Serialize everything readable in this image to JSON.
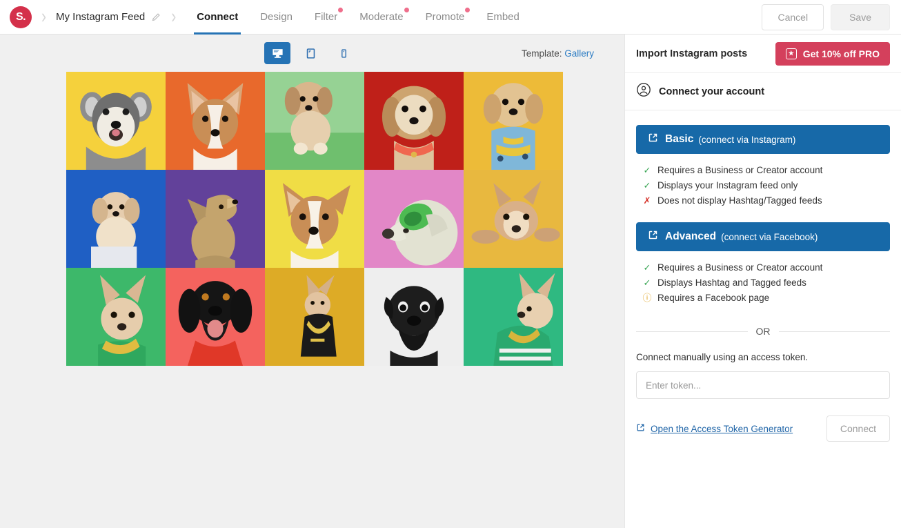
{
  "topbar": {
    "logo_text": "S.",
    "feed_name": "My Instagram Feed",
    "tabs": [
      {
        "label": "Connect",
        "active": true,
        "dot": false
      },
      {
        "label": "Design",
        "active": false,
        "dot": false
      },
      {
        "label": "Filter",
        "active": false,
        "dot": true
      },
      {
        "label": "Moderate",
        "active": false,
        "dot": true
      },
      {
        "label": "Promote",
        "active": false,
        "dot": true
      },
      {
        "label": "Embed",
        "active": false,
        "dot": false
      }
    ],
    "cancel_label": "Cancel",
    "save_label": "Save",
    "accent_active": "#2573b5",
    "dot_color": "#ef6e8b",
    "logo_color": "#d4304a"
  },
  "preview": {
    "devices": [
      {
        "name": "desktop",
        "active": true
      },
      {
        "name": "tablet",
        "active": false
      },
      {
        "name": "mobile",
        "active": false
      }
    ],
    "template_label": "Template:",
    "template_value": "Gallery",
    "photos": [
      {
        "bg": "#f5d13c",
        "alt": "schnauzer puppy on yellow"
      },
      {
        "bg": "#e8692c",
        "alt": "corgi puppy on orange"
      },
      {
        "bg": "#96d294",
        "alt": "shih tzu on green"
      },
      {
        "bg": "#bf2019",
        "alt": "shih tzu on red"
      },
      {
        "bg": "#edbb38",
        "alt": "poodle in blue shirt on yellow"
      },
      {
        "bg": "#1f5fc4",
        "alt": "maltese on blue"
      },
      {
        "bg": "#62419a",
        "alt": "chihuahua looking up on purple"
      },
      {
        "bg": "#f0dd45",
        "alt": "corgi puppy on yellow"
      },
      {
        "bg": "#e287c7",
        "alt": "retriever with green visor on pink"
      },
      {
        "bg": "#e8b83f",
        "alt": "french bulldog lying on yellow"
      },
      {
        "bg": "#3db86a",
        "alt": "french bulldog in green shirt"
      },
      {
        "bg": "#f4635e",
        "alt": "black dog with red bandana"
      },
      {
        "bg": "#ddab26",
        "alt": "french bulldog with gold chain"
      },
      {
        "bg": "#eeeeee",
        "alt": "black pug on white"
      },
      {
        "bg": "#2fb981",
        "alt": "french bulldog in green jersey"
      }
    ]
  },
  "panel": {
    "header_title": "Import Instagram posts",
    "pro_button": "Get 10% off PRO",
    "pro_color": "#d4405c",
    "account_title": "Connect your account",
    "options": [
      {
        "title": "Basic",
        "subtitle": "(connect via Instagram)",
        "features": [
          {
            "mark": "ok",
            "text": "Requires a Business or Creator account"
          },
          {
            "mark": "ok",
            "text": "Displays your Instagram feed only"
          },
          {
            "mark": "no",
            "text": "Does not display Hashtag/Tagged feeds"
          }
        ]
      },
      {
        "title": "Advanced",
        "subtitle": "(connect via Facebook)",
        "features": [
          {
            "mark": "ok",
            "text": "Requires a Business or Creator account"
          },
          {
            "mark": "ok",
            "text": "Displays Hashtag and Tagged feeds"
          },
          {
            "mark": "warn",
            "text": "Requires a Facebook page"
          }
        ]
      }
    ],
    "or_text": "OR",
    "manual_label": "Connect manually using an access token.",
    "token_placeholder": "Enter token...",
    "token_value": "",
    "generator_link": "Open the Access Token Generator",
    "connect_label": "Connect",
    "button_color": "#1769a8"
  }
}
